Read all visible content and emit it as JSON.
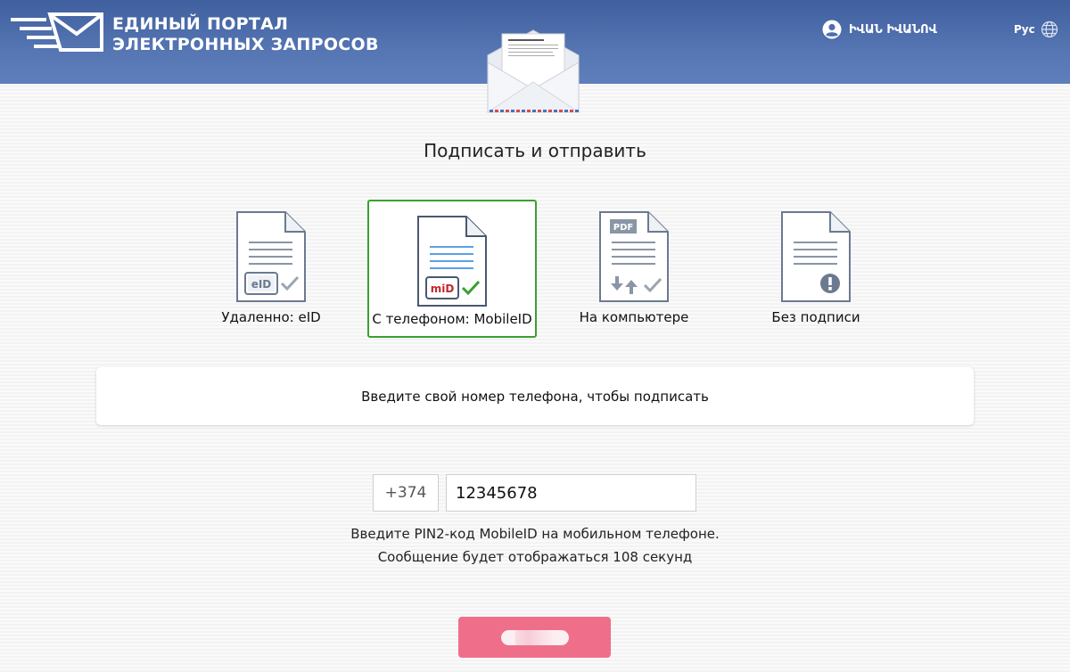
{
  "header": {
    "title_line1": "ЕДИНЫЙ ПОРТАЛ",
    "title_line2": "ЭЛЕКТРОННЫХ ЗАПРОСОВ",
    "user_name": "ԻՎԱՆ ԻՎԱՆՈՎ",
    "language": "Рус"
  },
  "heading": "Подписать и отправить",
  "options": [
    {
      "label": "Удаленно: eID",
      "badge": "eID",
      "icon": "eid-document-icon",
      "selected": false
    },
    {
      "label": "С телефоном: MobileID",
      "badge": "miD",
      "icon": "mobileid-document-icon",
      "selected": true
    },
    {
      "label": "На компьютере",
      "badge": "PDF",
      "icon": "pdf-document-icon",
      "selected": false
    },
    {
      "label": "Без подписи",
      "icon": "document-warning-icon",
      "selected": false
    }
  ],
  "info_message": "Введите свой номер телефона, чтобы подписать",
  "phone": {
    "country_code": "+374",
    "number": "12345678"
  },
  "hint_line1": "Введите PIN2-код MobileID на мобильном телефоне.",
  "hint_line2": "Сообщение будет отображаться 108 секунд",
  "colors": {
    "header": "#5070b0",
    "selected_border": "#3aa02e",
    "submit_button": "#ef6f8a"
  }
}
